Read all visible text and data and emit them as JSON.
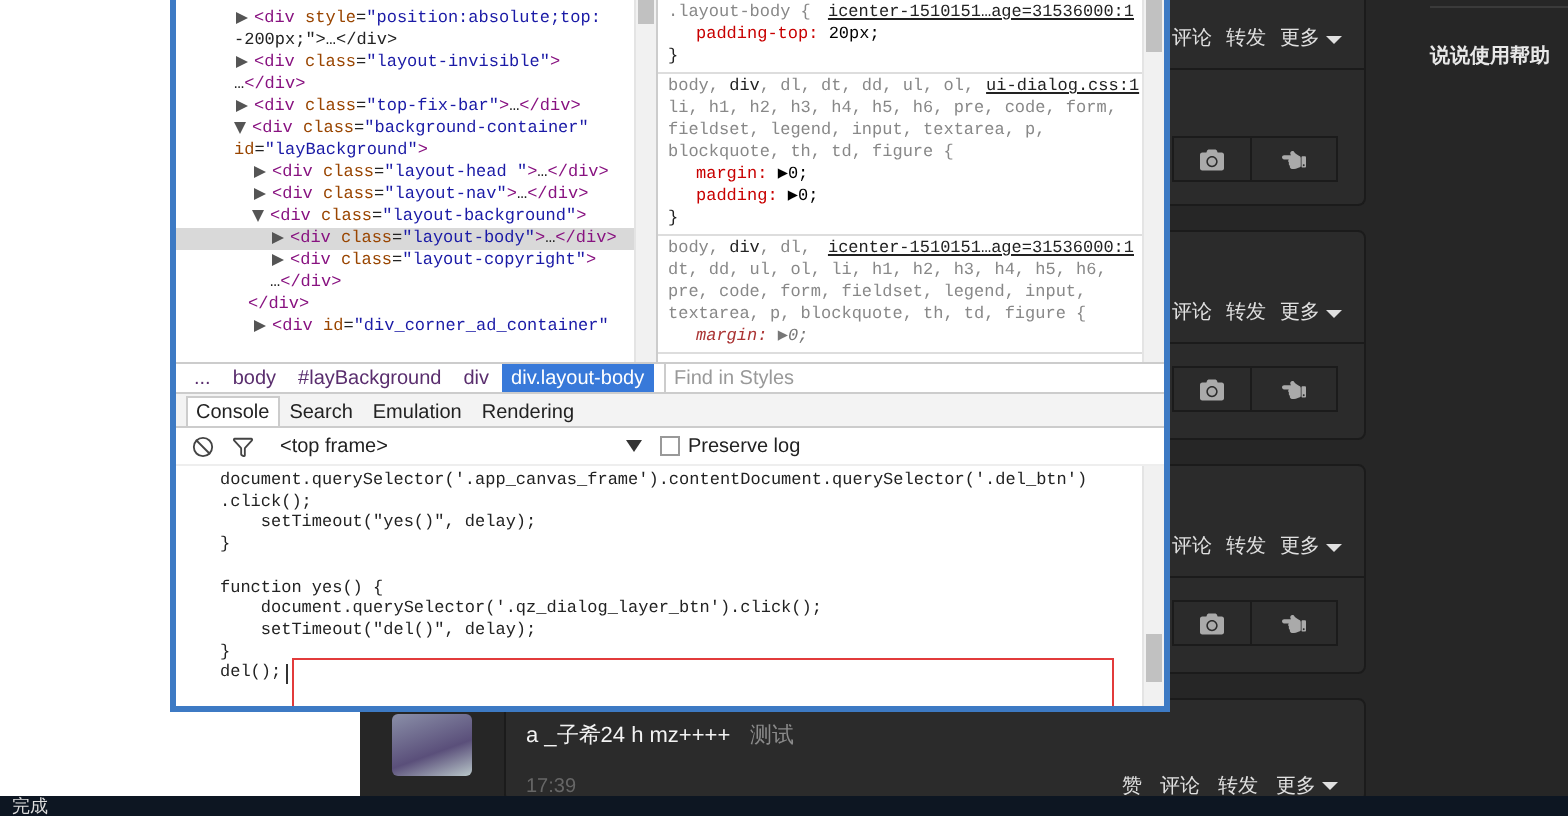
{
  "devtools": {
    "elements_tree": [
      {
        "markup": [
          "<div style=\"position:absolute;top:",
          "-200px;\">…</div>"
        ],
        "expanded": false,
        "selected": false
      },
      {
        "markup": [
          "<div class=\"layout-invisible\">",
          "…</div>"
        ],
        "expanded": false,
        "selected": false
      },
      {
        "markup": [
          "<div class=\"top-fix-bar\">…</div>"
        ],
        "expanded": false,
        "selected": false
      },
      {
        "markup": [
          "<div class=\"background-container\"",
          "id=\"layBackground\">"
        ],
        "expanded": true,
        "selected": false,
        "children": [
          {
            "markup": [
              "<div class=\"layout-head \">…</div>"
            ],
            "expanded": false,
            "selected": false
          },
          {
            "markup": [
              "<div class=\"layout-nav\">…</div>"
            ],
            "expanded": false,
            "selected": false
          },
          {
            "markup": [
              "<div class=\"layout-background\">"
            ],
            "expanded": true,
            "selected": false,
            "closing": "</div>",
            "children": [
              {
                "markup": [
                  "<div class=\"layout-body\">…</div>"
                ],
                "expanded": false,
                "selected": true
              },
              {
                "markup": [
                  "<div class=\"layout-copyright\">",
                  "…</div>"
                ],
                "expanded": false,
                "selected": false
              }
            ]
          },
          {
            "markup": [
              "<div id=\"div_corner_ad_container\""
            ],
            "expanded": false,
            "selected": false
          }
        ]
      }
    ],
    "styles": {
      "rules": [
        {
          "selector_lines": [
            ".layout-body {"
          ],
          "source": "icenter-1510151…age=31536000:1",
          "properties": [
            {
              "name": "padding-top:",
              "value": "20px;",
              "overridden": false
            }
          ],
          "closing": "}"
        },
        {
          "selector_lines": [
            "body, **div**, dl, dt, dd, ul, ol,",
            "li, h1, h2, h3, h4, h5, h6, pre, code, form,",
            "fieldset, legend, input, textarea, p,",
            "blockquote, th, td, figure {"
          ],
          "source": "ui-dialog.css:1",
          "properties": [
            {
              "name": "margin:",
              "value": "▶0;",
              "overridden": false
            },
            {
              "name": "padding:",
              "value": "▶0;",
              "overridden": false
            }
          ],
          "closing": "}"
        },
        {
          "selector_lines": [
            "body, **div**, dl,",
            "dt, dd, ul, ol, li, h1, h2, h3, h4, h5, h6,",
            "pre, code, form, fieldset, legend, input,",
            "textarea, p, blockquote, th, td, figure {"
          ],
          "source": "icenter-1510151…age=31536000:1",
          "properties": [
            {
              "name": "margin:",
              "value": "▶0;",
              "overridden": true
            }
          ]
        }
      ],
      "filter_placeholder": "Find in Styles"
    },
    "breadcrumbs": [
      {
        "label": "...",
        "selected": false
      },
      {
        "label": "body",
        "selected": false
      },
      {
        "label": "#layBackground",
        "selected": false
      },
      {
        "label": "div",
        "selected": false
      },
      {
        "label": "div.layout-body",
        "selected": true
      }
    ],
    "tabs": [
      {
        "label": "Console",
        "selected": true
      },
      {
        "label": "Search",
        "selected": false
      },
      {
        "label": "Emulation",
        "selected": false
      },
      {
        "label": "Rendering",
        "selected": false
      }
    ],
    "console": {
      "context": "<top frame>",
      "preserve_log": {
        "label": "Preserve log",
        "checked": false
      },
      "code": "document.querySelector('.app_canvas_frame').contentDocument.querySelector('.del_btn')\n.click();\n    setTimeout(\"yes()\", delay);\n}\n\nfunction yes() {\n    document.querySelector('.qz_dialog_layer_btn').click();\n    setTimeout(\"del()\", delay);\n}\n",
      "input": "del();"
    }
  },
  "feed": [
    {
      "kind": "toolbar",
      "actions": [
        "评论",
        "转发",
        "更多"
      ]
    },
    {
      "kind": "toolbar",
      "actions": [
        "评论",
        "转发",
        "更多"
      ]
    },
    {
      "kind": "toolbar",
      "actions": [
        "评论",
        "转发",
        "更多"
      ]
    },
    {
      "kind": "post",
      "author": "a _子希24 h mz++++",
      "text": "测试",
      "time": "17:39",
      "actions": [
        "赞",
        "评论",
        "转发",
        "更多"
      ]
    }
  ],
  "sidebar": {
    "help_link": "说说使用帮助"
  },
  "status_bar": {
    "text": "完成"
  }
}
